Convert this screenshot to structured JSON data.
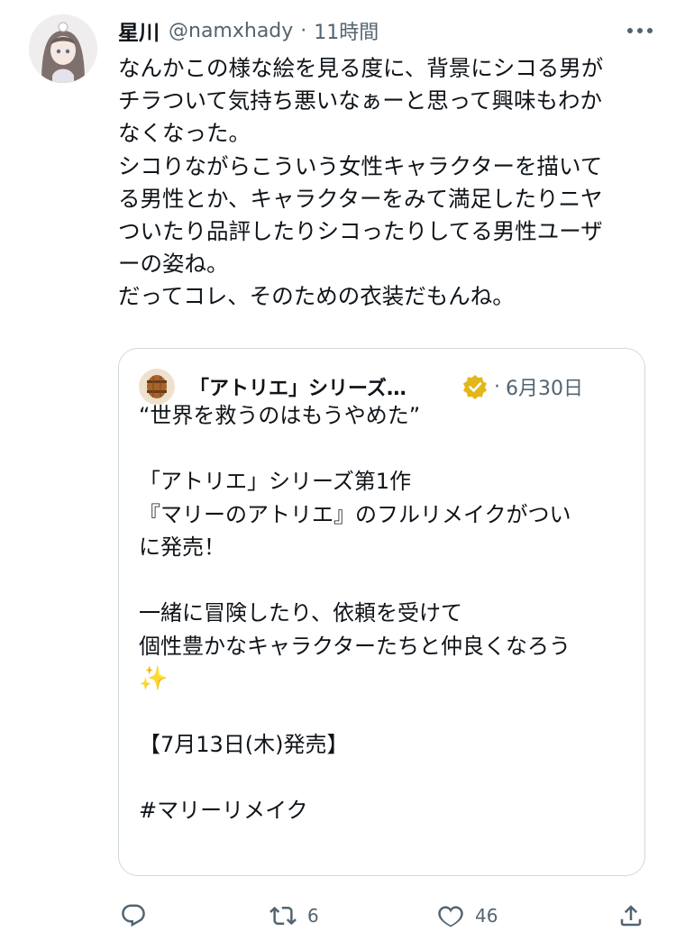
{
  "tweet": {
    "author_name": "星川",
    "author_handle": "@namxhady",
    "separator": "·",
    "time": "11時間",
    "lines": [
      "なんかこの様な絵を見る度に、背景にシコる男が",
      "チラついて気持ち悪いなぁーと思って興味もわか",
      "なくなった。",
      "シコりながらこういう女性キャラクターを描いて",
      "る男性とか、キャラクターをみて満足したりニヤ",
      "ついたり品評したりシコったりしてる男性ユーザ",
      "ーの姿ね。",
      "だってコレ、そのための衣装だもんね。"
    ]
  },
  "quote": {
    "author_name": "「アトリエ」シリーズ…",
    "meta_fragment": "·",
    "date": "6月30日",
    "lines": [
      "“世界を救うのはもうやめた”",
      "",
      "「アトリエ」シリーズ第1作",
      "『マリーのアトリエ』のフルリメイクがつい",
      "に発売！",
      "",
      "一緒に冒険したり、依頼を受けて",
      "個性豊かなキャラクターたちと仲良くなろう",
      "✨",
      "",
      "【7月13日(木)発売】",
      "",
      "#マリーリメイク"
    ]
  },
  "actions": {
    "reply_icon": "reply-icon",
    "retweet_icon": "retweet-icon",
    "retweet_count": "6",
    "like_icon": "heart-icon",
    "like_count": "46",
    "share_icon": "share-icon"
  },
  "colors": {
    "text": "#0f1419",
    "secondary": "#536471",
    "border": "#cfd9de",
    "verified_gold": "#e2b719"
  }
}
